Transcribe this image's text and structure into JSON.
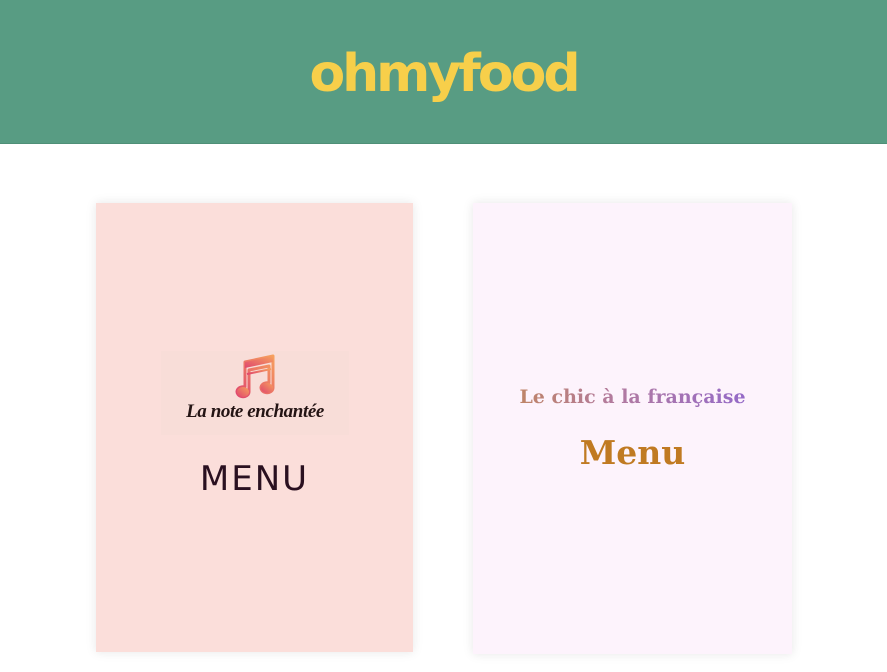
{
  "header": {
    "logo_text": "ohmyfood"
  },
  "restaurants": [
    {
      "name": "La note enchantée",
      "menu_label": "MENU",
      "icon": "music-note-icon"
    },
    {
      "name": "Le chic à la française",
      "menu_label": "Menu"
    }
  ],
  "colors": {
    "header_bg": "#589c83",
    "logo": "#f7cf4a",
    "card_left_bg": "#fbdeda",
    "card_right_bg": "#fdf3fc",
    "menu_right": "#c07a22"
  }
}
